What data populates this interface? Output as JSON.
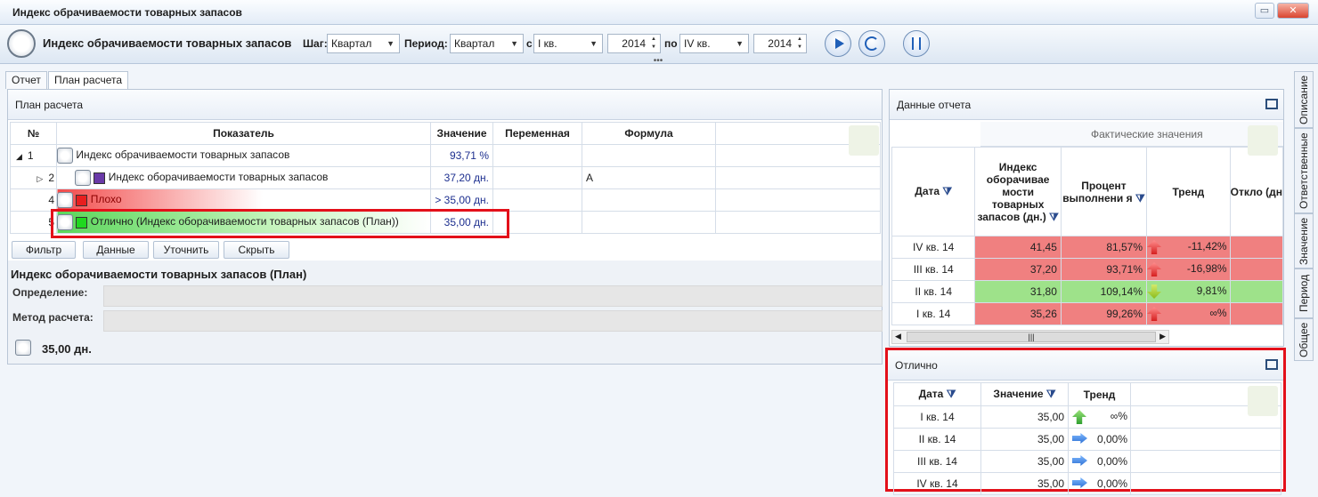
{
  "window": {
    "title": "Индекс обрачиваемости товарных запасов"
  },
  "toolbar": {
    "title": "Индекс обрачиваемости товарных запасов",
    "step_label": "Шаг:",
    "step_value": "Квартал",
    "period_label": "Период:",
    "period_value": "Квартал",
    "from_label": "с",
    "from_quarter": "I кв.",
    "from_year": "2014",
    "to_label": "по",
    "to_quarter": "IV кв.",
    "to_year": "2014"
  },
  "tabs": [
    "Отчет",
    "План расчета"
  ],
  "plan": {
    "header": "План расчета",
    "columns": [
      "№",
      "Показатель",
      "Значение",
      "Переменная",
      "Формула"
    ],
    "rows": [
      {
        "num": "1",
        "name": "Индекс обрачиваемости товарных запасов",
        "value": "93,71 %",
        "var": "",
        "formula": ""
      },
      {
        "num": "2",
        "name": "Индекс оборачиваемости товарных запасов",
        "value": "37,20 дн.",
        "var": "",
        "formula": "A"
      },
      {
        "num": "4",
        "name": "Плохо",
        "value": "> 35,00 дн.",
        "var": "",
        "formula": ""
      },
      {
        "num": "5",
        "name": "Отлично (Индекс оборачиваемости товарных запасов (План))",
        "value": "35,00 дн.",
        "var": "",
        "formula": ""
      }
    ],
    "buttons": [
      "Фильтр",
      "Данные",
      "Уточнить",
      "Скрыть"
    ],
    "detail_title": "Индекс оборачиваемости товарных запасов (План)",
    "definition_label": "Определение:",
    "method_label": "Метод расчета:",
    "value": "35,00 дн."
  },
  "report": {
    "header": "Данные отчета",
    "group_header": "Фактические значения",
    "columns": [
      "Дата",
      "Индекс оборачивае мости товарных запасов (дн.)",
      "Процент выполнени я",
      "Тренд",
      "Откло (дн"
    ],
    "rows": [
      {
        "date": "IV кв. 14",
        "index": "41,45",
        "pct": "81,57%",
        "trend": "-11,42%",
        "color": "red",
        "arrow": "up-red"
      },
      {
        "date": "III кв. 14",
        "index": "37,20",
        "pct": "93,71%",
        "trend": "-16,98%",
        "color": "red",
        "arrow": "up-red"
      },
      {
        "date": "II кв. 14",
        "index": "31,80",
        "pct": "109,14%",
        "trend": "9,81%",
        "color": "green",
        "arrow": "down-green"
      },
      {
        "date": "I кв. 14",
        "index": "35,26",
        "pct": "99,26%",
        "trend": "∞%",
        "color": "red",
        "arrow": "up-red"
      }
    ]
  },
  "excellent": {
    "header": "Отлично",
    "columns": [
      "Дата",
      "Значение",
      "Тренд"
    ],
    "rows": [
      {
        "date": "I кв. 14",
        "value": "35,00",
        "trend": "∞%",
        "arrow": "up-green"
      },
      {
        "date": "II кв. 14",
        "value": "35,00",
        "trend": "0,00%",
        "arrow": "right"
      },
      {
        "date": "III кв. 14",
        "value": "35,00",
        "trend": "0,00%",
        "arrow": "right"
      },
      {
        "date": "IV кв. 14",
        "value": "35,00",
        "trend": "0,00%",
        "arrow": "right"
      }
    ]
  },
  "side_tabs": [
    "Описание",
    "Ответственные",
    "Значение",
    "Период",
    "Общее"
  ]
}
